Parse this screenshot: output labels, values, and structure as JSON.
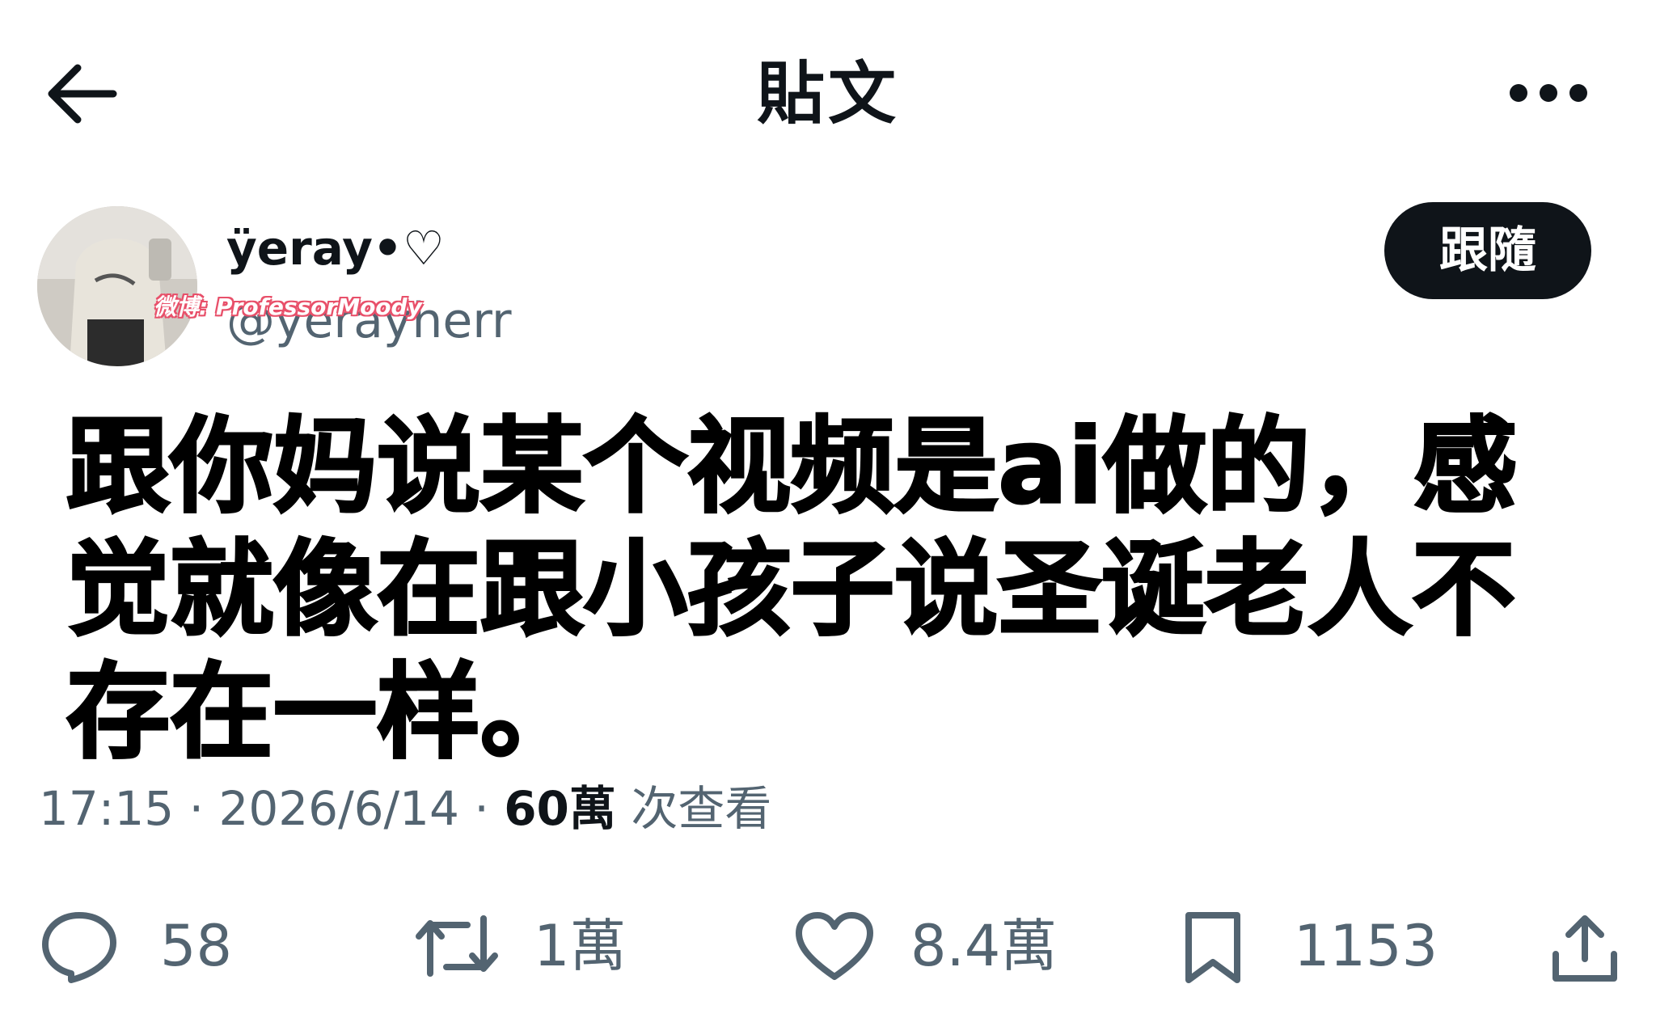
{
  "header": {
    "title": "貼文"
  },
  "author": {
    "display_name": "ÿeray•♡",
    "handle": "@yerayherr",
    "watermark": "微博: ProfessorMoody"
  },
  "follow_label": "跟隨",
  "tweet": {
    "text": "跟你妈说某个视频是ai做的，感觉就像在跟小孩子说圣诞老人不存在一样。",
    "time": "17:15",
    "date": "2026/6/14",
    "views": "60萬",
    "views_label": "次查看"
  },
  "actions": {
    "replies": "58",
    "reposts": "1萬",
    "likes": "8.4萬",
    "bookmarks": "1153"
  },
  "colors": {
    "primary_text": "#0f1419",
    "secondary_text": "#536471",
    "button_bg": "#0f1419"
  }
}
